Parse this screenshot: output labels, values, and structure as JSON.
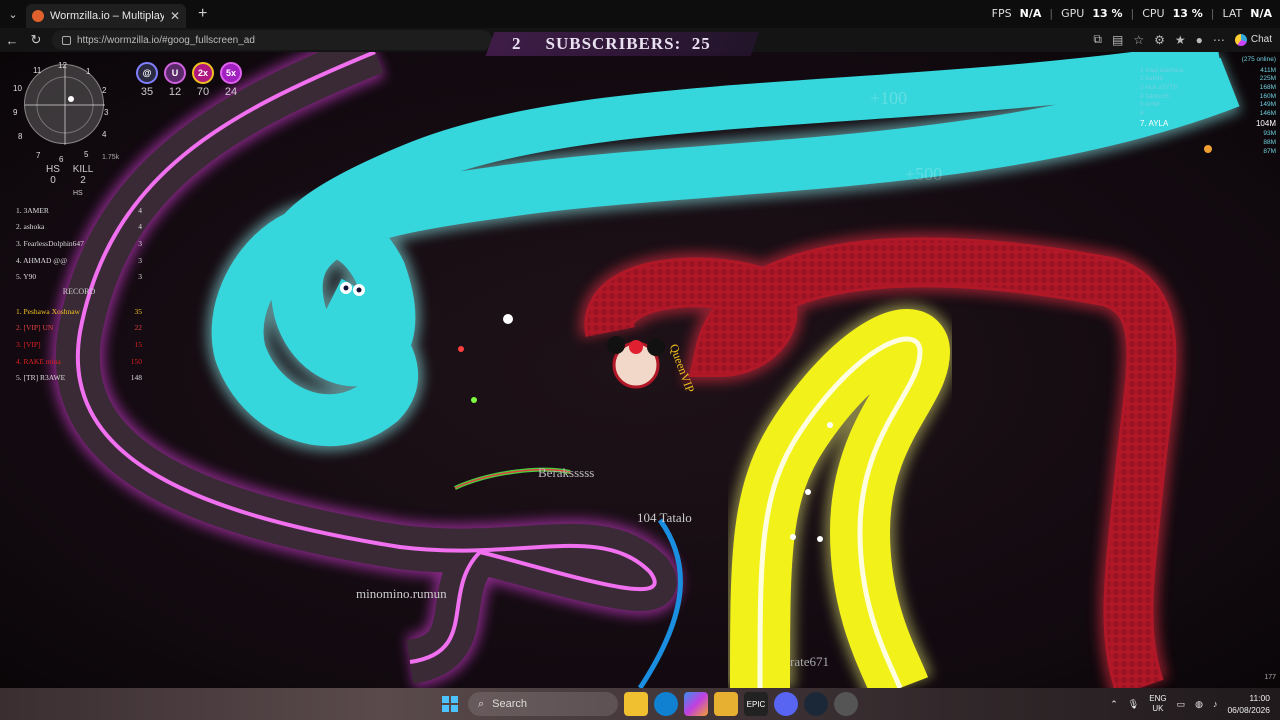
{
  "browser": {
    "tab_title": "Wormzilla.io – Multiplayer Snake G",
    "url": "https://wormzilla.io/#goog_fullscreen_ad",
    "chat_label": "Chat",
    "perf": {
      "fps_label": "FPS",
      "fps_value": "N/A",
      "gpu_label": "GPU",
      "gpu_value": "13 %",
      "cpu_label": "CPU",
      "cpu_value": "13 %",
      "lat_label": "LAT",
      "lat_value": "N/A"
    }
  },
  "banner": {
    "left_value": "2",
    "text": "SUBSCRIBERS:",
    "count": "25"
  },
  "hud": {
    "minimap_numbers": [
      "11",
      "12",
      "1",
      "10",
      "2",
      "9",
      "3",
      "8",
      "4",
      "7",
      "6",
      "5"
    ],
    "scale": "1.75k",
    "boosts": [
      {
        "icon": "spiral-icon",
        "value": "35",
        "color": "#2a2a40"
      },
      {
        "icon": "magnet-icon",
        "value": "12",
        "color": "#5a2a6a"
      },
      {
        "icon": "2x-icon",
        "label": "2x",
        "value": "70",
        "color": "#b01880"
      },
      {
        "icon": "5x-icon",
        "label": "5x",
        "value": "24",
        "color": "#a020c0"
      }
    ],
    "hs_label": "HS",
    "kill_label": "KILL",
    "hs_value": "0",
    "kill_value": "2",
    "hs_tag": "HS",
    "headshot_board": [
      {
        "name": "1. 3AMER",
        "score": "4"
      },
      {
        "name": "2. ashoka",
        "score": "4"
      },
      {
        "name": "3. FearlessDolphin647",
        "score": "3"
      },
      {
        "name": "4. AHMAD @@",
        "score": "3"
      },
      {
        "name": "5. Y90",
        "score": "3"
      }
    ],
    "record_label": "RECORD",
    "record_board": [
      {
        "name": "1. Peshawa Xoshnaw",
        "score": "35"
      },
      {
        "name": "2. [VIP] UN",
        "score": "22"
      },
      {
        "name": "3. [VIP]",
        "score": "15"
      },
      {
        "name": "4. RAKE mina",
        "score": "150"
      },
      {
        "name": "5. [TR] R3AWE",
        "score": "148"
      }
    ]
  },
  "top_leaderboard": {
    "online": "(275 online)",
    "rows": [
      {
        "name": "1 Iraqi dakhara",
        "score": "411M"
      },
      {
        "name": "2 bab4b",
        "score": "225M"
      },
      {
        "name": "3 kick.x5YTb",
        "score": "168M"
      },
      {
        "name": "4 faktreo5",
        "score": "160M"
      },
      {
        "name": "5 AHM",
        "score": "149M"
      },
      {
        "name": "6",
        "score": "146M"
      }
    ],
    "me": {
      "name": "7. AYLA",
      "score": "104M"
    },
    "tail": [
      "93M",
      "88M",
      "87M"
    ]
  },
  "players": {
    "queen": "QueenVIP",
    "bera": "Beraksssss",
    "tatalo": "104 Tatalo",
    "minomino": "minomino.rumun",
    "rate": "rate671"
  },
  "floating_points": [
    "+100",
    "+500"
  ],
  "corner_number": "177",
  "taskbar": {
    "search_placeholder": "Search",
    "lang_top": "ENG",
    "lang_bottom": "UK",
    "time": "11:00",
    "date": "06/08/2026"
  },
  "colors": {
    "cyan": "#35d6dc",
    "red": "#b01828",
    "yellow": "#f2f21a",
    "magenta": "#e040e0",
    "blue": "#1a8ee0"
  }
}
